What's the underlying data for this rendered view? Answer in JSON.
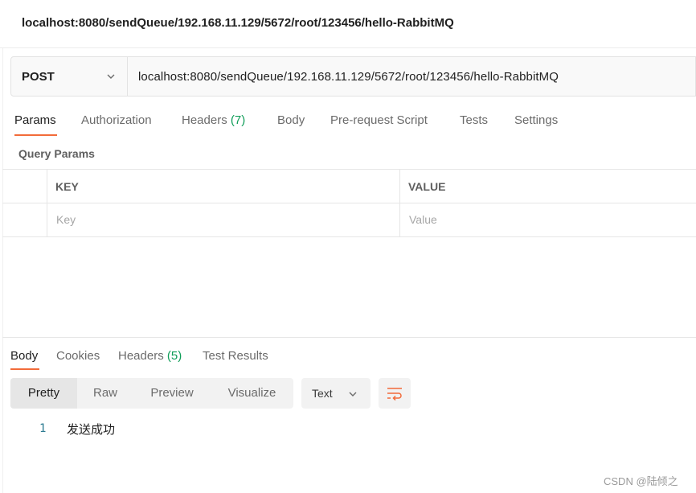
{
  "window": {
    "title": "localhost:8080/sendQueue/192.168.11.129/5672/root/123456/hello-RabbitMQ"
  },
  "request": {
    "method": "POST",
    "url": "localhost:8080/sendQueue/192.168.11.129/5672/root/123456/hello-RabbitMQ"
  },
  "request_tabs": {
    "params": "Params",
    "authorization": "Authorization",
    "headers": "Headers",
    "headers_count": "(7)",
    "body": "Body",
    "prerequest": "Pre-request Script",
    "tests": "Tests",
    "settings": "Settings"
  },
  "query_params": {
    "title": "Query Params",
    "columns": [
      "KEY",
      "VALUE"
    ],
    "placeholders": [
      "Key",
      "Value"
    ]
  },
  "response_tabs": {
    "body": "Body",
    "cookies": "Cookies",
    "headers": "Headers",
    "headers_count": "(5)",
    "test_results": "Test Results"
  },
  "view_modes": [
    "Pretty",
    "Raw",
    "Preview",
    "Visualize"
  ],
  "format": {
    "selected": "Text"
  },
  "response_body": {
    "line_number": "1",
    "content": "发送成功"
  },
  "watermark": "CSDN @陆倾之",
  "colors": {
    "accent": "#f26b3a",
    "count": "#0f9d58"
  },
  "icons": {
    "method_dropdown": "chevron-down-icon",
    "format_dropdown": "chevron-down-icon",
    "wrap": "wrap-lines-icon"
  }
}
